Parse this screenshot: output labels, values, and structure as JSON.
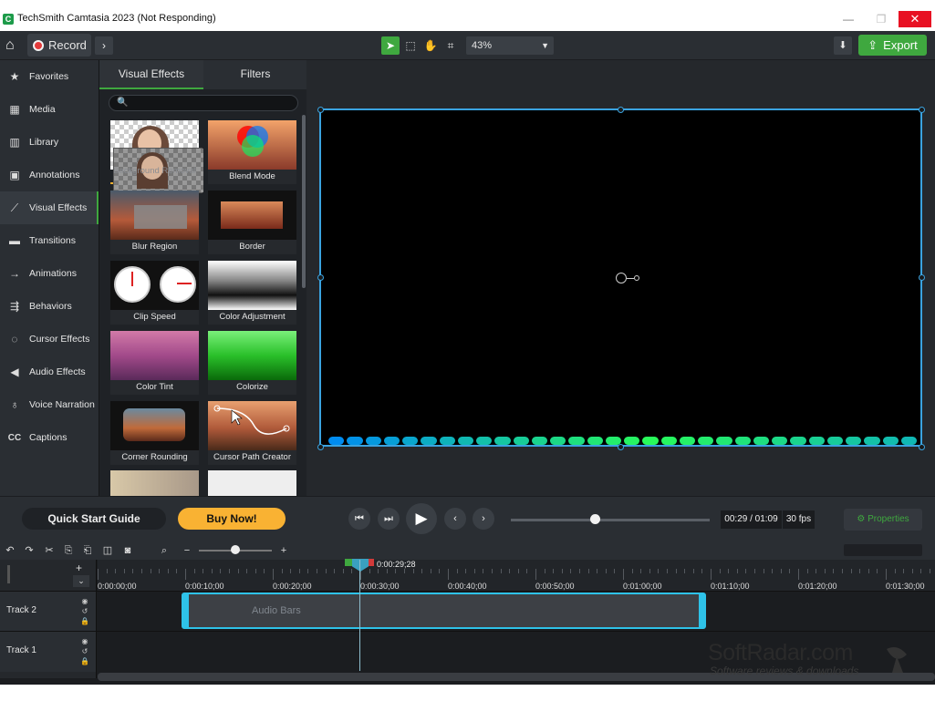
{
  "window": {
    "title": "TechSmith Camtasia 2023 (Not Responding)",
    "app_icon": "C"
  },
  "toolbar": {
    "record_label": "Record",
    "zoom_value": "43%",
    "export_label": "Export"
  },
  "nav": {
    "items": [
      {
        "label": "Favorites",
        "icon": "star-icon"
      },
      {
        "label": "Media",
        "icon": "film-icon"
      },
      {
        "label": "Library",
        "icon": "library-icon"
      },
      {
        "label": "Annotations",
        "icon": "annotation-icon"
      },
      {
        "label": "Visual Effects",
        "icon": "wand-icon",
        "active": true
      },
      {
        "label": "Transitions",
        "icon": "transition-icon"
      },
      {
        "label": "Animations",
        "icon": "animation-icon"
      },
      {
        "label": "Behaviors",
        "icon": "behavior-icon"
      },
      {
        "label": "Cursor Effects",
        "icon": "cursor-icon"
      },
      {
        "label": "Audio Effects",
        "icon": "speaker-icon"
      },
      {
        "label": "Voice Narration",
        "icon": "microphone-icon"
      },
      {
        "label": "Captions",
        "icon": "cc-icon"
      }
    ]
  },
  "panel": {
    "tabs": [
      "Visual Effects",
      "Filters"
    ],
    "search_placeholder": "",
    "tiles": [
      {
        "label": "Background Removal"
      },
      {
        "label": "Blend Mode"
      },
      {
        "label": "Blur Region"
      },
      {
        "label": "Border"
      },
      {
        "label": "Clip Speed"
      },
      {
        "label": "Color Adjustment"
      },
      {
        "label": "Color Tint"
      },
      {
        "label": "Colorize"
      },
      {
        "label": "Corner Rounding"
      },
      {
        "label": "Cursor Path Creator"
      }
    ]
  },
  "playback": {
    "quick_start_label": "Quick Start Guide",
    "buy_label": "Buy Now!",
    "timecode": "00:29 / 01:09",
    "fps": "30 fps",
    "properties_label": "Properties",
    "scrub_fraction": 0.42
  },
  "timeline": {
    "playhead_time": "0:00:29;28",
    "ruler_labels": [
      "0:00:00;00",
      "0:00:10;00",
      "0:00:20;00",
      "0:00:30;00",
      "0:00:40;00",
      "0:00:50;00",
      "0:01:00;00",
      "0:01:10;00",
      "0:01:20;00",
      "0:01:30;00"
    ],
    "tracks": [
      "Track 2",
      "Track 1"
    ],
    "clip_label": "Audio Bars"
  },
  "watermark": {
    "brand": "SoftRadar.com",
    "tagline": "Software reviews & downloads"
  },
  "colors": {
    "accent": "#3fa83f",
    "selection": "#3aa3e0",
    "buy": "#f9b233"
  }
}
